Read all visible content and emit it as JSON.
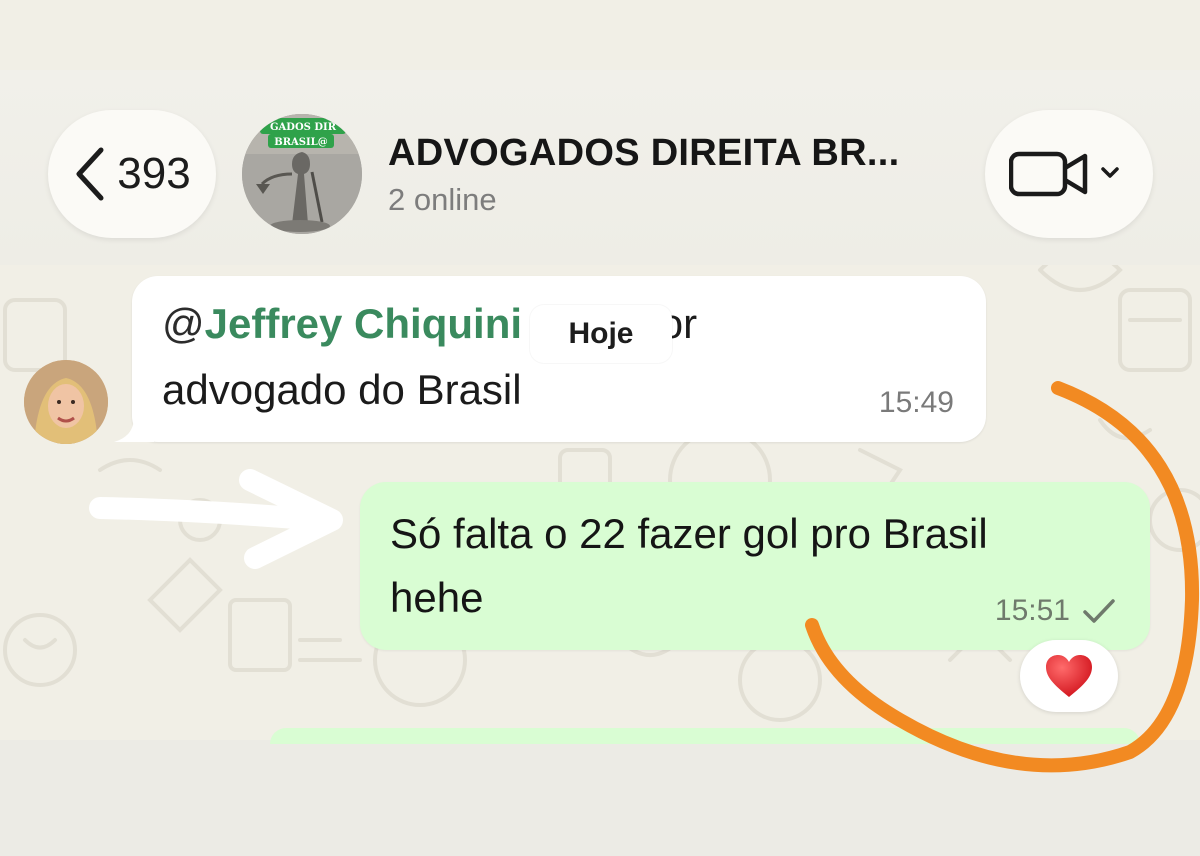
{
  "header": {
    "back_count": "393",
    "group_name": "ADVOGADOS DIREITA BR...",
    "status": "2 online",
    "avatar_banner_text_1": "GADOS DIR",
    "avatar_banner_text_2": "BRASIL@"
  },
  "date_separator": "Hoje",
  "messages": [
    {
      "direction": "incoming",
      "mention_at": "@",
      "mention_name": "Jeffrey Chiquini",
      "line1_rest": " o melhor",
      "line2": "advogado do Brasil",
      "time": "15:49"
    },
    {
      "direction": "outgoing",
      "line1": "Só falta o 22 fazer gol pro Brasil",
      "line2": "hehe",
      "time": "15:51",
      "reaction": "❤️"
    }
  ],
  "colors": {
    "outgoing_bubble": "#d9fdd3",
    "mention": "#3a8a5e",
    "annotation": "#f28a22"
  },
  "icons": [
    "chevron-left-icon",
    "video-call-icon",
    "chevron-down-icon",
    "single-check-icon",
    "heart-reaction-icon",
    "arrow-annotation",
    "circle-annotation"
  ]
}
